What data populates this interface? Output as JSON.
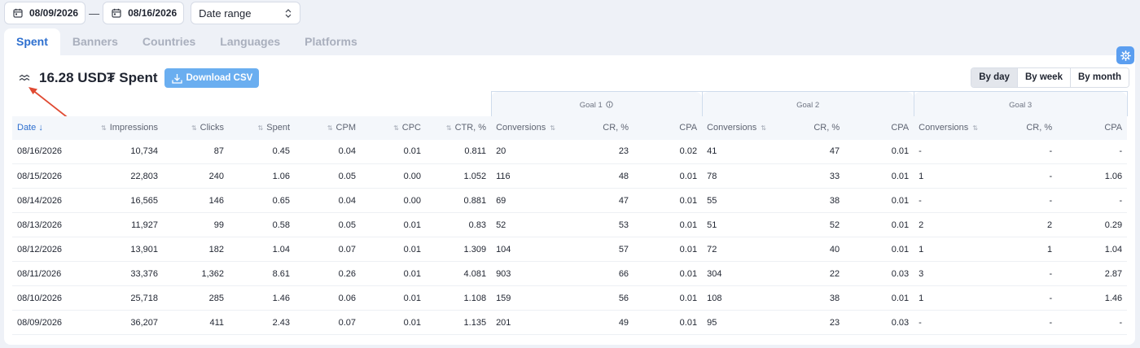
{
  "filters": {
    "date_from": "08/09/2026",
    "date_to": "08/16/2026",
    "separator": "—",
    "range_select": "Date range"
  },
  "tabs": [
    {
      "label": "Spent",
      "active": true
    },
    {
      "label": "Banners"
    },
    {
      "label": "Countries"
    },
    {
      "label": "Languages"
    },
    {
      "label": "Platforms"
    }
  ],
  "summary": {
    "title": "16.28 USD₮ Spent",
    "download_label": "Download CSV"
  },
  "period": [
    "By day",
    "By week",
    "By month"
  ],
  "period_active": "By day",
  "goals": [
    "Goal 1",
    "Goal 2",
    "Goal 3"
  ],
  "columns": {
    "date": "Date",
    "impressions": "Impressions",
    "clicks": "Clicks",
    "spent": "Spent",
    "cpm": "CPM",
    "cpc": "CPC",
    "ctr": "CTR, %",
    "conversions": "Conversions",
    "cr": "CR, %",
    "cpa": "CPA"
  },
  "rows": [
    [
      "08/16/2026",
      "10,734",
      "87",
      "0.45",
      "0.04",
      "0.01",
      "0.811",
      "20",
      "23",
      "0.02",
      "41",
      "47",
      "0.01",
      "-",
      "-",
      "-"
    ],
    [
      "08/15/2026",
      "22,803",
      "240",
      "1.06",
      "0.05",
      "0.00",
      "1.052",
      "116",
      "48",
      "0.01",
      "78",
      "33",
      "0.01",
      "1",
      "-",
      "1.06"
    ],
    [
      "08/14/2026",
      "16,565",
      "146",
      "0.65",
      "0.04",
      "0.00",
      "0.881",
      "69",
      "47",
      "0.01",
      "55",
      "38",
      "0.01",
      "-",
      "-",
      "-"
    ],
    [
      "08/13/2026",
      "11,927",
      "99",
      "0.58",
      "0.05",
      "0.01",
      "0.83",
      "52",
      "53",
      "0.01",
      "51",
      "52",
      "0.01",
      "2",
      "2",
      "0.29"
    ],
    [
      "08/12/2026",
      "13,901",
      "182",
      "1.04",
      "0.07",
      "0.01",
      "1.309",
      "104",
      "57",
      "0.01",
      "72",
      "40",
      "0.01",
      "1",
      "1",
      "1.04"
    ],
    [
      "08/11/2026",
      "33,376",
      "1,362",
      "8.61",
      "0.26",
      "0.01",
      "4.081",
      "903",
      "66",
      "0.01",
      "304",
      "22",
      "0.03",
      "3",
      "-",
      "2.87"
    ],
    [
      "08/10/2026",
      "25,718",
      "285",
      "1.46",
      "0.06",
      "0.01",
      "1.108",
      "159",
      "56",
      "0.01",
      "108",
      "38",
      "0.01",
      "1",
      "-",
      "1.46"
    ],
    [
      "08/09/2026",
      "36,207",
      "411",
      "2.43",
      "0.07",
      "0.01",
      "1.135",
      "201",
      "49",
      "0.01",
      "95",
      "23",
      "0.03",
      "-",
      "-",
      "-"
    ]
  ],
  "colors": {
    "accent": "#2d6fcf",
    "csv_button": "#6aaef0",
    "settings_button": "#5b9ef0",
    "annotation_arrow": "#e04a32"
  },
  "icons": {
    "calendar": "calendar-icon",
    "select": "chevron-updown-icon",
    "chart_toggle": "chart-toggle-icon",
    "download": "download-icon",
    "settings": "gear-icon",
    "info": "info-icon",
    "sort": "sort-icon"
  }
}
